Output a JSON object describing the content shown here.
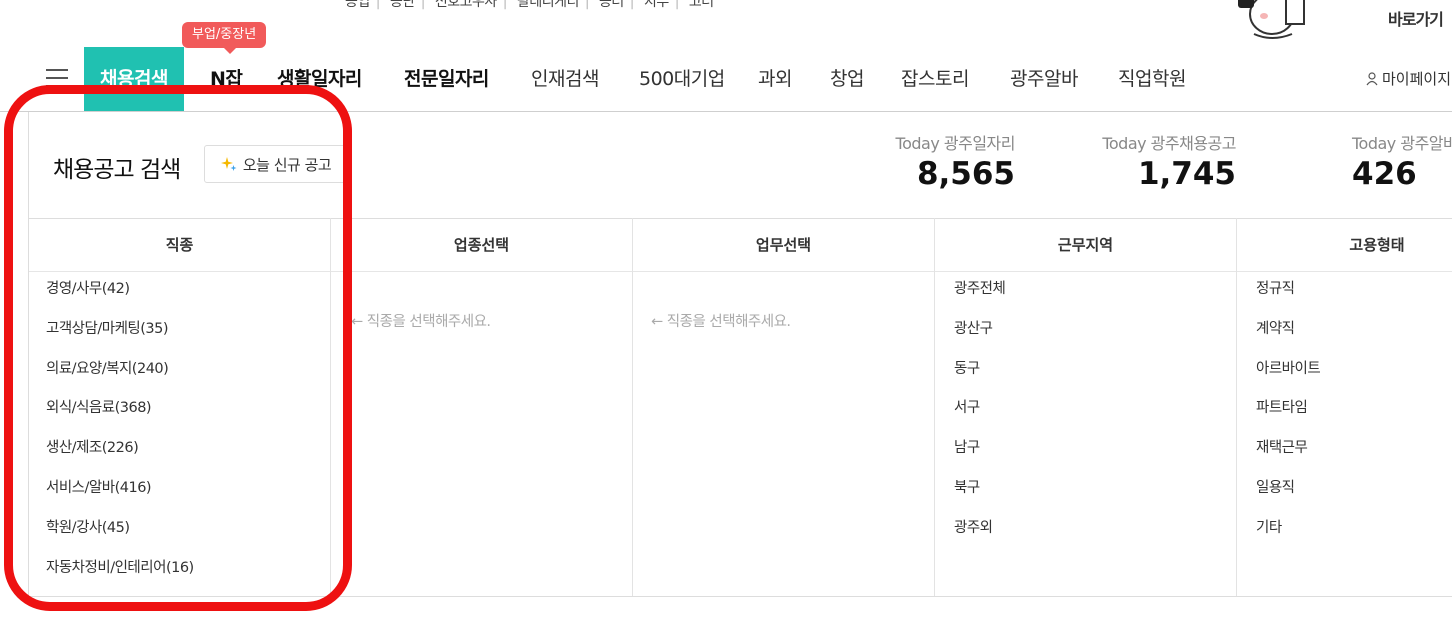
{
  "top": {
    "links": [
      "공업",
      "공단",
      "전호고우사",
      "팔레리게티",
      "공터",
      "지부",
      "고터"
    ],
    "shortcut_label": "바로가기"
  },
  "nav": {
    "badge": "부업/중장년",
    "items": [
      {
        "label": "채용검색",
        "state": "active"
      },
      {
        "label": "N잡",
        "state": "bold"
      },
      {
        "label": "생활일자리",
        "state": "bold"
      },
      {
        "label": "전문일자리",
        "state": "bold"
      },
      {
        "label": "인재검색"
      },
      {
        "label": "500대기업"
      },
      {
        "label": "과외"
      },
      {
        "label": "창업"
      },
      {
        "label": "잡스토리"
      },
      {
        "label": "광주알바"
      },
      {
        "label": "직업학원"
      }
    ],
    "mypage_label": "마이페이지",
    "accent_color": "#20c1b1",
    "badge_color": "#f15a5a"
  },
  "search": {
    "title": "채용공고 검색",
    "new_jobs_button": "오늘 신규 공고"
  },
  "stats": [
    {
      "label": "Today 광주일자리",
      "value": "8,565"
    },
    {
      "label": "Today 광주채용공고",
      "value": "1,745"
    },
    {
      "label": "Today 광주알바",
      "value": "426"
    }
  ],
  "columns": {
    "job_type": {
      "header": "직종",
      "items": [
        "경영/사무(42)",
        "고객상담/마케팅(35)",
        "의료/요양/복지(240)",
        "외식/식음료(368)",
        "생산/제조(226)",
        "서비스/알바(416)",
        "학원/강사(45)",
        "자동차정비/인테리어(16)"
      ]
    },
    "industry": {
      "header": "업종선택",
      "placeholder": "← 직종을 선택해주세요."
    },
    "duty": {
      "header": "업무선택",
      "placeholder": "← 직종을 선택해주세요."
    },
    "region": {
      "header": "근무지역",
      "items": [
        "광주전체",
        "광산구",
        "동구",
        "서구",
        "남구",
        "북구",
        "광주외"
      ]
    },
    "employment": {
      "header": "고용형태",
      "items": [
        "정규직",
        "계약직",
        "아르바이트",
        "파트타임",
        "재택근무",
        "일용직",
        "기타"
      ]
    }
  },
  "annotation": {
    "color": "#ee1111"
  }
}
